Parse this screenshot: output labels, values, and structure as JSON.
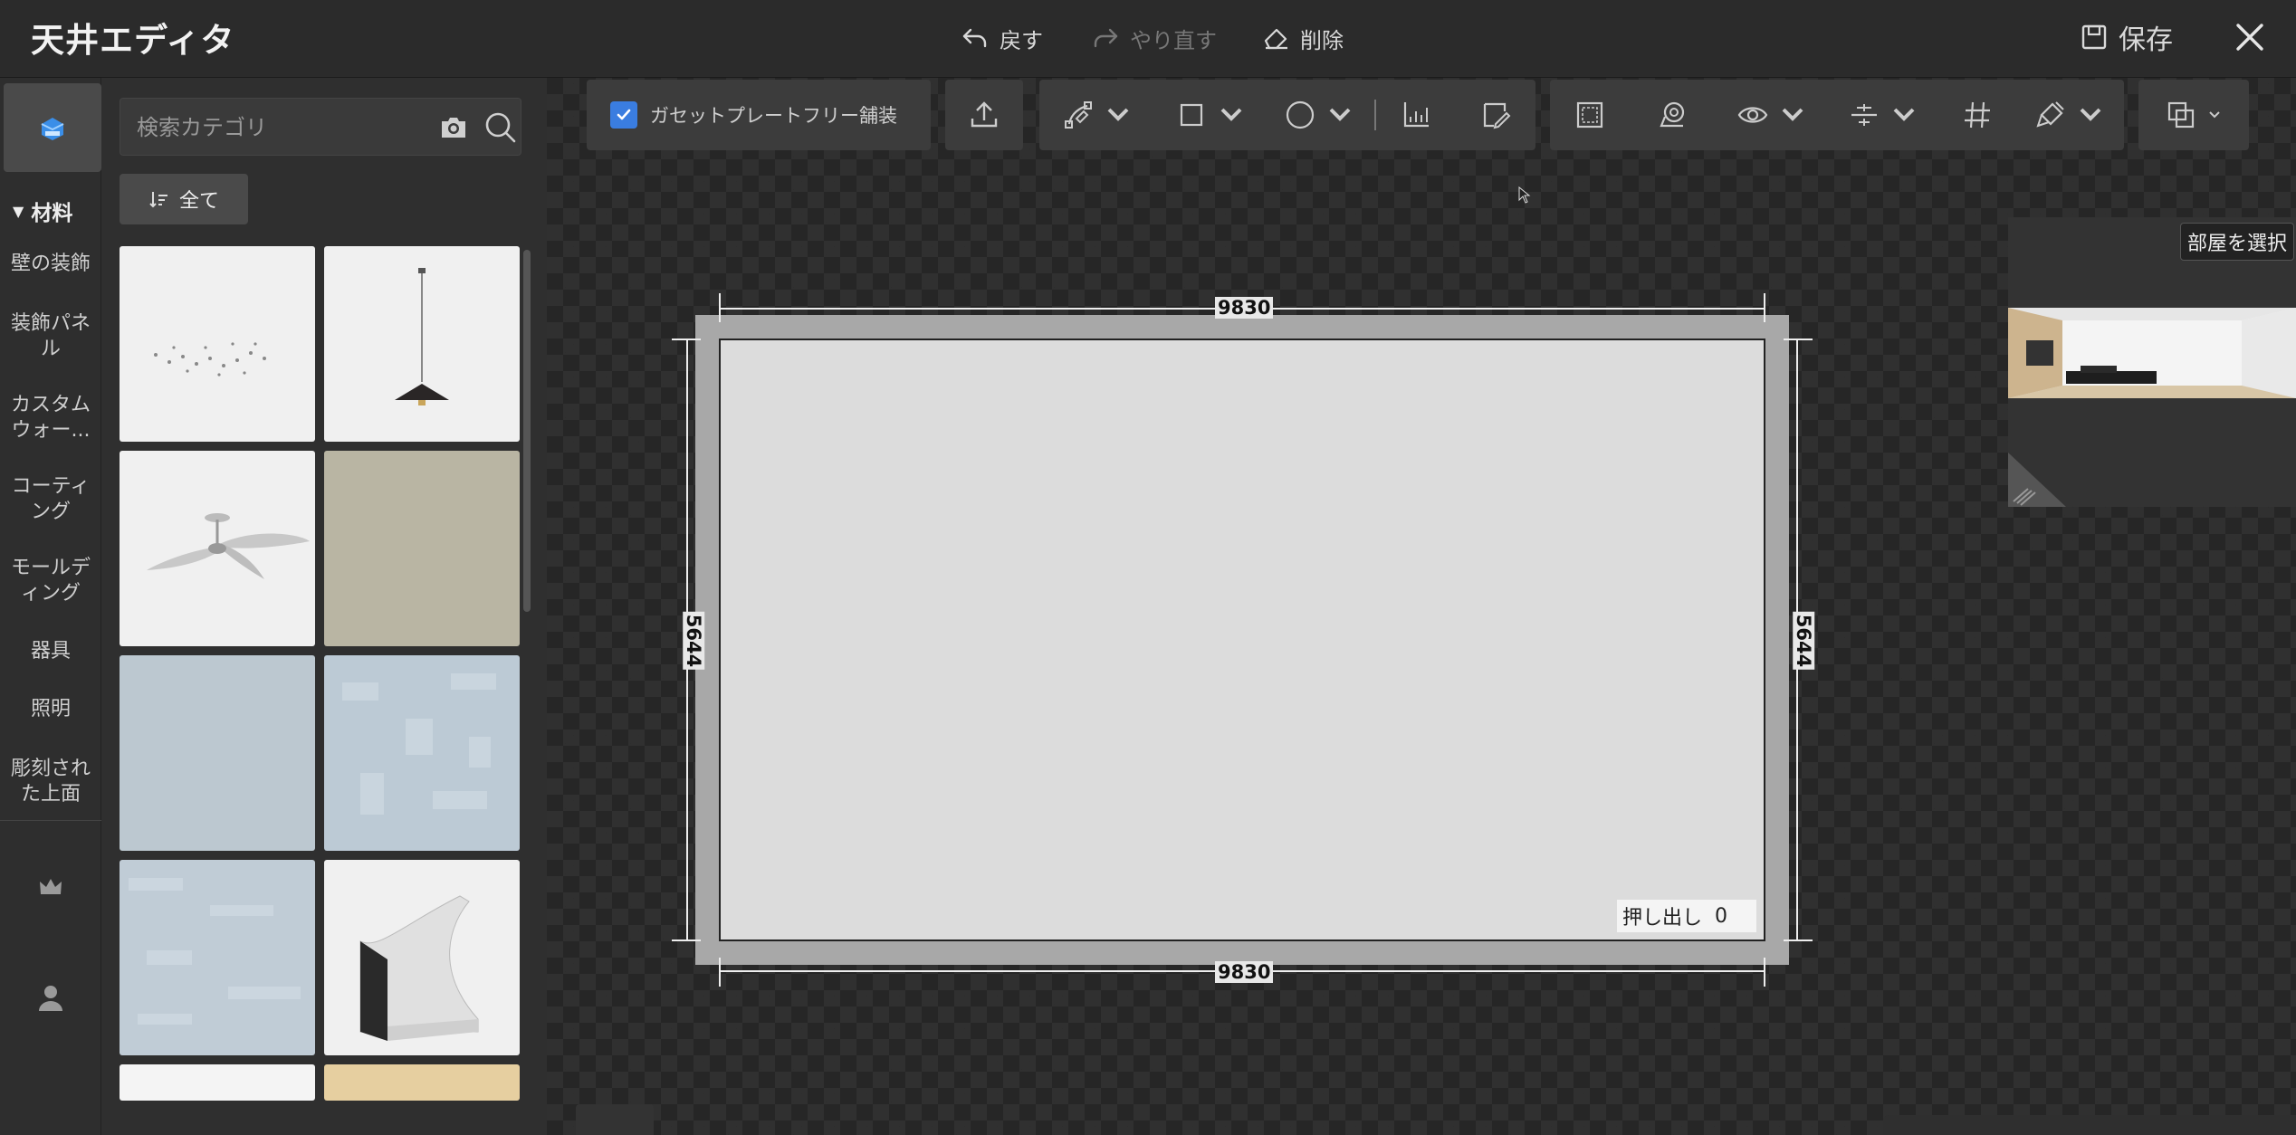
{
  "header": {
    "title": "天井エディタ",
    "undo_label": "戻す",
    "redo_label": "やり直す",
    "delete_label": "削除",
    "save_label": "保存"
  },
  "sidebar": {
    "category_header": "材料",
    "categories": [
      {
        "label_line1": "壁の装飾",
        "label_line2": ""
      },
      {
        "label_line1": "装飾パネ",
        "label_line2": "ル"
      },
      {
        "label_line1": "カスタム",
        "label_line2": "ウォー..."
      },
      {
        "label_line1": "コーティ",
        "label_line2": "ング"
      },
      {
        "label_line1": "モールデ",
        "label_line2": "ィング"
      },
      {
        "label_line1": "器具",
        "label_line2": ""
      },
      {
        "label_line1": "照明",
        "label_line2": ""
      },
      {
        "label_line1": "彫刻され",
        "label_line2": "た上面"
      }
    ]
  },
  "library": {
    "search_placeholder": "検索カテゴリ",
    "filter_label": "全て",
    "tiles": [
      {
        "name": "crystal-ceiling-light",
        "color": "#f0f0f0"
      },
      {
        "name": "pendant-lamp",
        "color": "#f0f0f0"
      },
      {
        "name": "ceiling-fan",
        "color": "#f0f0f0"
      },
      {
        "name": "beige-material",
        "color": "#b9b5a3"
      },
      {
        "name": "blue-grey-material",
        "color": "#bcc8d0"
      },
      {
        "name": "blue-pattern-material",
        "color": "#bccad5"
      },
      {
        "name": "blue-texture-material",
        "color": "#c0ccd6"
      },
      {
        "name": "cove-molding",
        "color": "#f0f0f0"
      },
      {
        "name": "white-material",
        "color": "#f4f4f4"
      },
      {
        "name": "wood-material",
        "color": "#e6cfa0"
      }
    ]
  },
  "toolbar": {
    "gusset_label": "ガセットプレートフリー舗装",
    "gusset_checked": true,
    "accent": "#3a7de0"
  },
  "drawing": {
    "width_top": "9830",
    "width_bottom": "9830",
    "height_left": "5644",
    "height_right": "5644",
    "extrude_label": "押し出し",
    "extrude_value": "0"
  },
  "preview": {
    "room_select_label": "部屋を選択"
  }
}
